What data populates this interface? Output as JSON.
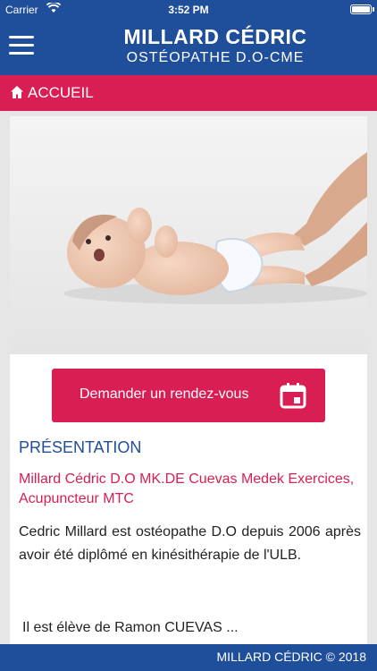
{
  "status_bar": {
    "carrier": "Carrier",
    "time": "3:52 PM"
  },
  "header": {
    "title": "MILLARD CÉDRIC",
    "subtitle": "OSTÉOPATHE D.O-CME"
  },
  "nav": {
    "label": "ACCUEIL"
  },
  "cta": {
    "label": "Demander un rendez-vous"
  },
  "section": {
    "title": "PRÉSENTATION",
    "subtitle": "Millard Cédric D.O MK.DE Cuevas Medek Exercices, Acupuncteur MTC",
    "paragraph": "Cedric Millard est ostéopathe D.O depuis 2006 après avoir été diplômé en kinésithérapie de l'ULB.",
    "paragraph2": "Il est élève de Ramon CUEVAS ..."
  },
  "footer": {
    "label": "MILLARD CÉDRIC © 2018"
  },
  "colors": {
    "primary": "#1f4e9a",
    "accent": "#d81e52"
  }
}
